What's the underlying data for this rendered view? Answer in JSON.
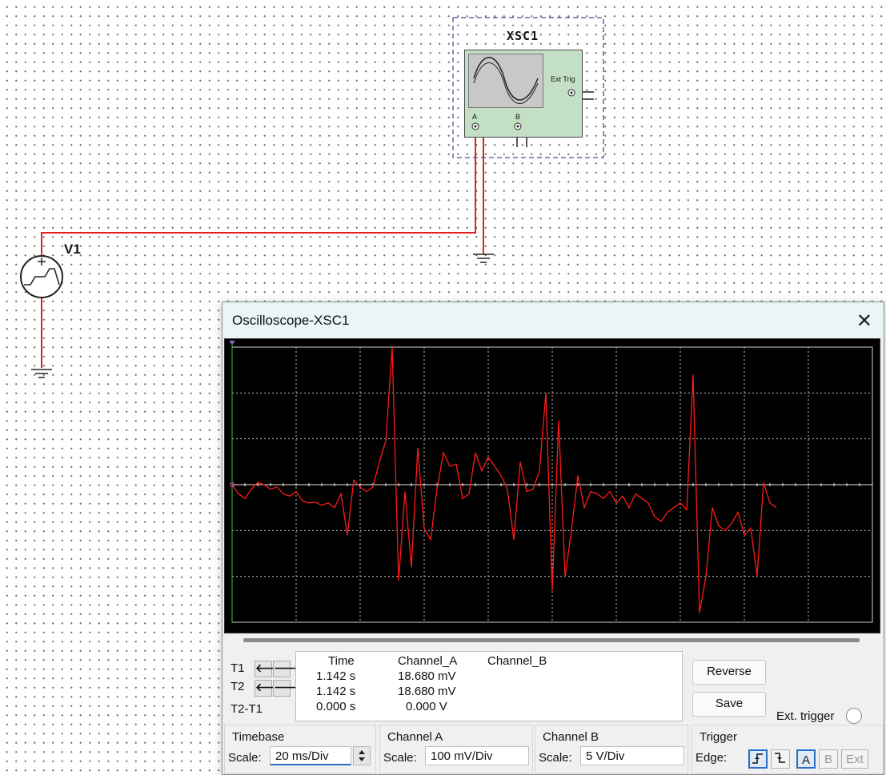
{
  "schematic": {
    "source_label": "V1",
    "scope_label": "XSC1",
    "scope_ext_trig": "Ext Trig",
    "scope_ch_a": "A",
    "scope_ch_b": "B",
    "wire_color": "#e02020"
  },
  "window": {
    "title": "Oscilloscope-XSC1",
    "trace_color": "#ff1a1a",
    "grid_color": "#bdbdbd"
  },
  "cursors": {
    "t1_label": "T1",
    "t2_label": "T2",
    "diff_label": "T2-T1"
  },
  "readout": {
    "headers": [
      "Time",
      "Channel_A",
      "Channel_B"
    ],
    "rows": [
      [
        "1.142 s",
        "18.680 mV",
        ""
      ],
      [
        "1.142 s",
        "18.680 mV",
        ""
      ],
      [
        "0.000 s",
        "0.000 V",
        ""
      ]
    ]
  },
  "buttons": {
    "reverse": "Reverse",
    "save": "Save",
    "ext_trigger": "Ext. trigger"
  },
  "timebase": {
    "title": "Timebase",
    "scale_label": "Scale:",
    "scale_value": "20 ms/Div"
  },
  "channel_a": {
    "title": "Channel A",
    "scale_label": "Scale:",
    "scale_value": "100 mV/Div"
  },
  "channel_b": {
    "title": "Channel B",
    "scale_label": "Scale:",
    "scale_value": "5  V/Div"
  },
  "trigger": {
    "title": "Trigger",
    "edge_label": "Edge:",
    "src_a": "A",
    "src_b": "B",
    "src_ext": "Ext"
  },
  "chart_data": {
    "type": "line",
    "title": "",
    "xlabel": "",
    "ylabel": "",
    "x_divisions": 10,
    "y_divisions": 6,
    "x_unit": "ms",
    "y_unit": "mV",
    "x_per_div": 20,
    "y_per_div": 100,
    "grid": true,
    "series": [
      {
        "x": [
          0,
          2,
          4,
          6,
          8,
          10,
          12,
          14,
          16,
          18,
          20,
          22,
          24,
          26,
          28,
          30,
          32,
          34,
          36,
          38,
          40,
          42,
          44,
          46,
          48,
          50,
          52,
          54,
          56,
          58,
          60,
          62,
          64,
          66,
          68,
          70,
          72,
          74,
          76,
          78,
          80,
          82,
          84,
          86,
          88,
          90,
          92,
          94,
          96,
          98,
          100,
          102,
          104,
          106,
          108,
          110,
          112,
          114,
          116,
          118,
          120,
          122,
          124,
          126,
          128,
          130,
          132,
          134,
          136,
          138,
          140,
          142,
          144,
          146,
          148,
          150,
          152,
          154,
          156,
          158,
          160,
          162,
          164,
          166,
          168,
          170
        ],
        "values": [
          0,
          -20,
          -30,
          -10,
          5,
          0,
          -10,
          -5,
          -20,
          -25,
          -15,
          -35,
          -40,
          -38,
          -45,
          -40,
          -50,
          -20,
          -110,
          10,
          -5,
          -15,
          -5,
          50,
          95,
          300,
          -210,
          -15,
          -180,
          80,
          -95,
          -120,
          -10,
          70,
          40,
          45,
          -30,
          -20,
          70,
          30,
          60,
          40,
          20,
          -10,
          -120,
          50,
          -15,
          -10,
          30,
          200,
          -230,
          140,
          -200,
          -100,
          20,
          -50,
          -15,
          -20,
          -30,
          -15,
          -40,
          -25,
          -50,
          -20,
          -30,
          -40,
          -70,
          -80,
          -60,
          -50,
          -40,
          -55,
          240,
          -280,
          -200,
          -50,
          -90,
          -100,
          -85,
          -60,
          -110,
          -95,
          -200,
          5,
          -40,
          -50
        ]
      }
    ]
  }
}
